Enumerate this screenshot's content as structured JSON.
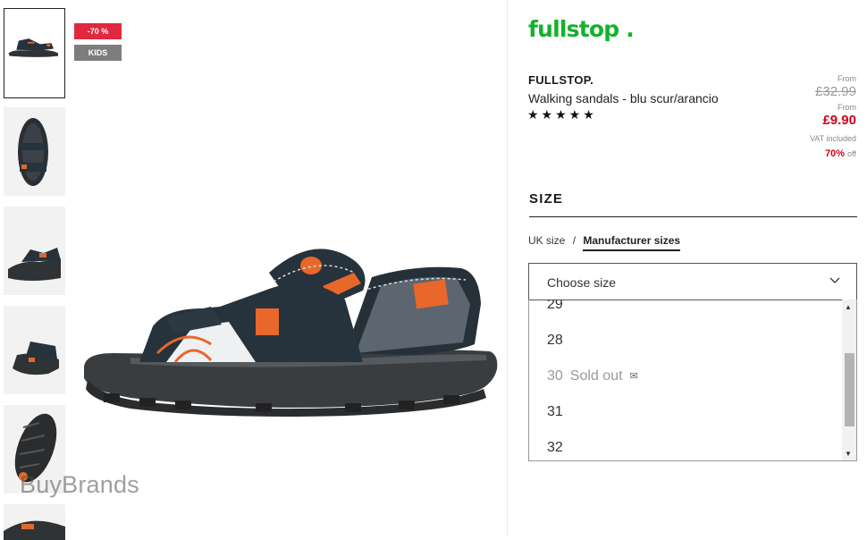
{
  "badges": {
    "sale": "-70 %",
    "kids": "KIDS"
  },
  "watermark": "BuyBrands",
  "brand": {
    "logo": "fullstop .",
    "name": "FULLSTOP."
  },
  "product": {
    "name": "Walking sandals - blu scur/arancio",
    "stars": "★★★★★",
    "rating": 5
  },
  "price": {
    "from_label_1": "From",
    "old": "£32.99",
    "from_label_2": "From",
    "new": "£9.90",
    "vat": "VAT included",
    "discount": "70%",
    "off": "off"
  },
  "size": {
    "heading": "SIZE",
    "tab_uk": "UK size",
    "separator": "/",
    "tab_manufacturer": "Manufacturer sizes",
    "select_value": "Choose size",
    "options": [
      {
        "size": "29"
      },
      {
        "size": "28"
      },
      {
        "size": "30",
        "status": "Sold out"
      },
      {
        "size": "31"
      },
      {
        "size": "32"
      }
    ]
  },
  "icons": {
    "chevron": "chevron-down-icon",
    "mail": "envelope-icon"
  },
  "colors": {
    "brand_green": "#13b22c",
    "sale_red": "#e0283f",
    "price_red": "#d0021b"
  }
}
